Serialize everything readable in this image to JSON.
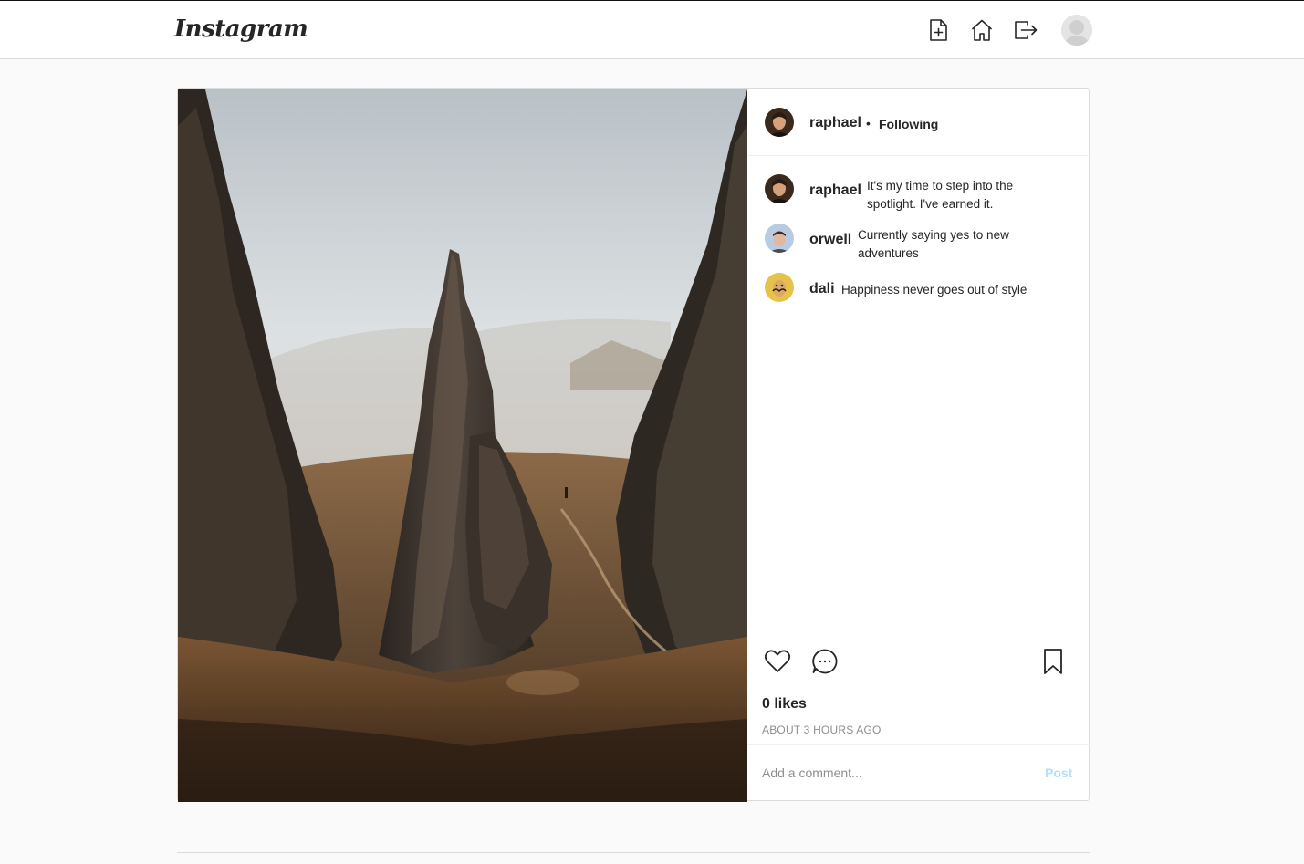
{
  "header": {
    "logo_text": "Instagram",
    "icons": [
      "new-post-icon",
      "home-icon",
      "logout-icon",
      "profile-avatar"
    ]
  },
  "post": {
    "author": {
      "username": "raphael",
      "separator": "•",
      "follow_status": "Following"
    },
    "comments": [
      {
        "username": "raphael",
        "text_line1": "It's my time to step into the",
        "text_line2": "spotlight. I've earned it."
      },
      {
        "username": "orwell",
        "text_line1": "Currently saying yes to new",
        "text_line2": "adventures"
      },
      {
        "username": "dali",
        "text_line1": "Happiness never goes out of style"
      }
    ],
    "likes_label": "0 likes",
    "timestamp": "ABOUT 3 HOURS AGO",
    "comment_input": {
      "placeholder": "Add a comment..."
    },
    "post_button_label": "Post",
    "colors": {
      "post_button": "#b2dffc",
      "border": "#dbdbdb"
    }
  }
}
